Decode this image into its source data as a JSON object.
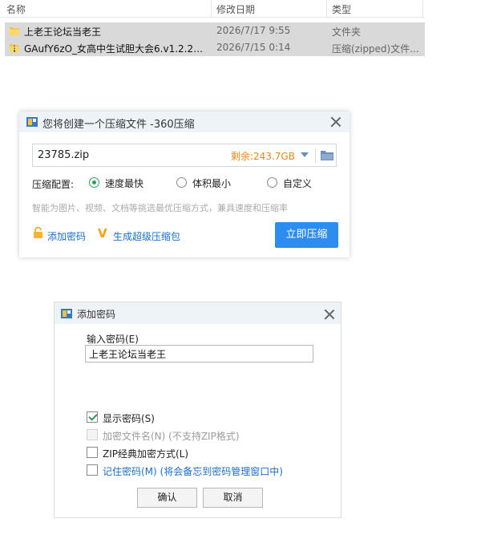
{
  "file_list": {
    "headers": {
      "name": "名称",
      "date": "修改日期",
      "type": "类型"
    },
    "rows": [
      {
        "name": "上老王论坛当老王",
        "date": "2026/7/17 9:55",
        "type": "文件夹",
        "icon": "folder-icon"
      },
      {
        "name": "GAufY6zO_女高中生试胆大会6.v1.2.2+...",
        "date": "2026/7/15 0:14",
        "type": "压缩(zipped)文件...",
        "icon": "zip-folder-icon"
      }
    ]
  },
  "compress_dialog": {
    "title": "您将创建一个压缩文件 -360压缩",
    "filename": "23785.zip",
    "remaining": "剩余:243.7GB",
    "config_label": "压缩配置:",
    "options": [
      "速度最快",
      "体积最小",
      "自定义"
    ],
    "selected_option": "速度最快",
    "hint": "智能为图片、视频、文档等挑选最优压缩方式，兼具速度和压缩率",
    "add_password_link": "添加密码",
    "super_package_link": "生成超级压缩包",
    "compress_button": "立即压缩",
    "accent_color": "#2d8cf0",
    "remain_color": "#e58a1e"
  },
  "password_dialog": {
    "title": "添加密码",
    "input_label": "输入密码(E)",
    "password_value": "上老王论坛当老王",
    "checkboxes": [
      {
        "label": "显示密码(S)",
        "checked": true,
        "disabled": false
      },
      {
        "label": "加密文件名(N) (不支持ZIP格式)",
        "checked": false,
        "disabled": true
      },
      {
        "label": "ZIP经典加密方式(L)",
        "checked": false,
        "disabled": false
      },
      {
        "label": "记住密码(M) (将会备忘到密码管理窗口中)",
        "checked": false,
        "disabled": false
      }
    ],
    "ok_button": "确认",
    "cancel_button": "取消"
  }
}
